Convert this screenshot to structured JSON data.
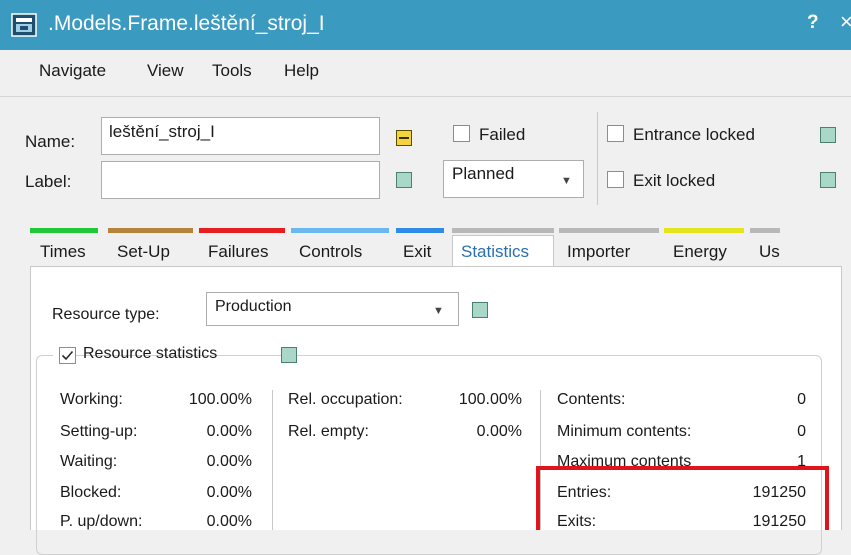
{
  "window": {
    "title": ".Models.Frame.leštění_stroj_I",
    "help_label": "?",
    "close_label": "×",
    "icon": "frame-window-icon"
  },
  "menu": [
    "Navigate",
    "View",
    "Tools",
    "Help"
  ],
  "header": {
    "name_label": "Name:",
    "name_value": "leštění_stroj_I",
    "label_label": "Label:",
    "label_value": "",
    "failed_label": "Failed",
    "failed_checked": false,
    "planned_value": "Planned",
    "entrance_locked_label": "Entrance locked",
    "entrance_locked_checked": false,
    "exit_locked_label": "Exit locked",
    "exit_locked_checked": false
  },
  "tabs": [
    {
      "label": "Times",
      "color": "#21c93a",
      "active": false
    },
    {
      "label": "Set-Up",
      "color": "#b5843a",
      "active": false
    },
    {
      "label": "Failures",
      "color": "#e61e1e",
      "active": false
    },
    {
      "label": "Controls",
      "color": "#6bb8f0",
      "active": false
    },
    {
      "label": "Exit",
      "color": "#2f8be8",
      "active": false
    },
    {
      "label": "Statistics",
      "color": "#b8b8b8",
      "active": true
    },
    {
      "label": "Importer",
      "color": "#b8b8b8",
      "active": false
    },
    {
      "label": "Energy",
      "color": "#e5e51d",
      "active": false
    },
    {
      "label": "Us",
      "color": "#b8b8b8",
      "active": false
    }
  ],
  "statistics": {
    "resource_type_label": "Resource type:",
    "resource_type_value": "Production",
    "resource_statistics_label": "Resource statistics",
    "resource_statistics_checked": true,
    "col1": [
      {
        "label": "Working:",
        "value": "100.00%"
      },
      {
        "label": "Setting-up:",
        "value": "0.00%"
      },
      {
        "label": "Waiting:",
        "value": "0.00%"
      },
      {
        "label": "Blocked:",
        "value": "0.00%"
      },
      {
        "label": "P. up/down:",
        "value": "0.00%"
      }
    ],
    "col2": [
      {
        "label": "Rel. occupation:",
        "value": "100.00%"
      },
      {
        "label": "Rel. empty:",
        "value": "0.00%"
      }
    ],
    "col3": [
      {
        "label": "Contents:",
        "value": "0"
      },
      {
        "label": "Minimum contents:",
        "value": "0"
      },
      {
        "label": "Maximum contents",
        "value": "1"
      },
      {
        "label": "Entries:",
        "value": "191250"
      },
      {
        "label": "Exits:",
        "value": "191250"
      }
    ]
  },
  "colors": {
    "title_bar": "#3b9abf",
    "highlight_box": "#e0141b",
    "inherit_square": "#a9d8c8",
    "modified_square": "#f3d43c",
    "active_tab_text": "#2a6fb0"
  }
}
